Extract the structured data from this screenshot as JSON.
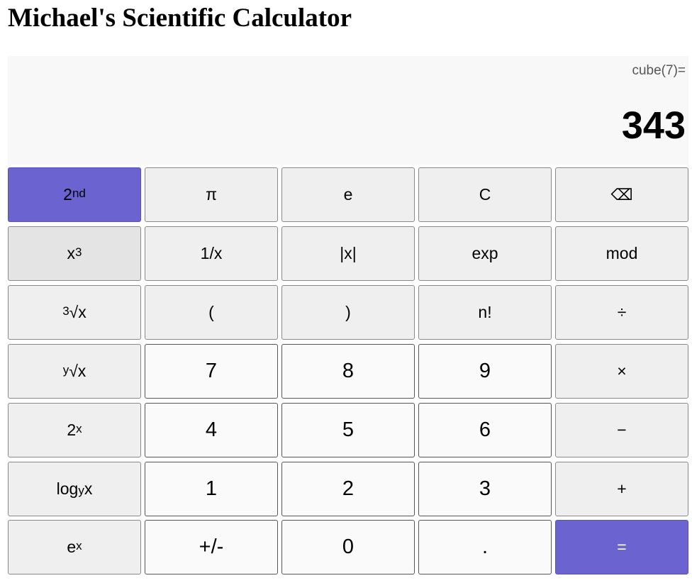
{
  "title": "Michael's Scientific Calculator",
  "display": {
    "expression": "cube(7)=",
    "result": "343"
  },
  "keys": {
    "second": {
      "base": "2",
      "sup": "nd"
    },
    "pi": "π",
    "e": "e",
    "clear": "C",
    "backspace": "⌫",
    "cube": {
      "base": "x",
      "sup": "3"
    },
    "reciprocal": "1/x",
    "abs": "|x|",
    "exp": "exp",
    "mod": "mod",
    "cbrt": {
      "sup": "3",
      "base": "√x"
    },
    "lparen": "(",
    "rparen": ")",
    "factorial": "n!",
    "divide": "÷",
    "yroot": {
      "sup": "y",
      "base": "√x"
    },
    "seven": "7",
    "eight": "8",
    "nine": "9",
    "multiply": "×",
    "pow2": {
      "base": "2",
      "sup": "x"
    },
    "four": "4",
    "five": "5",
    "six": "6",
    "minus": "−",
    "logy": {
      "base": "log",
      "sub": "y",
      "tail": "x"
    },
    "one": "1",
    "two": "2",
    "three": "3",
    "plus": "+",
    "expx": {
      "base": "e",
      "sup": "x"
    },
    "negate": "+/-",
    "zero": "0",
    "decimal": ".",
    "equals": "="
  },
  "colors": {
    "accent": "#6b63d0"
  }
}
